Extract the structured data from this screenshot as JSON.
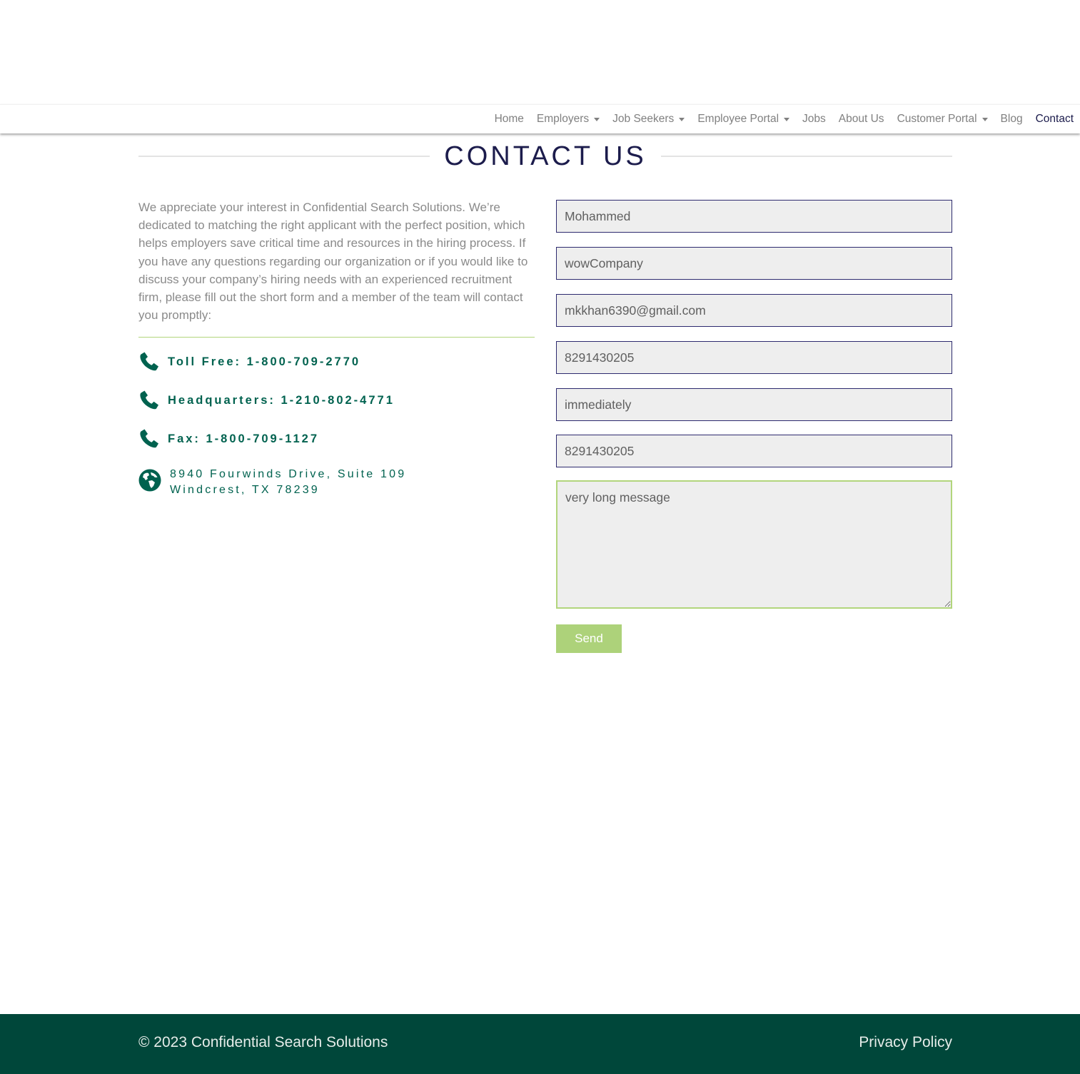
{
  "nav": {
    "items": [
      {
        "label": "Home",
        "dropdown": false
      },
      {
        "label": "Employers",
        "dropdown": true
      },
      {
        "label": "Job Seekers",
        "dropdown": true
      },
      {
        "label": "Employee Portal",
        "dropdown": true
      },
      {
        "label": "Jobs",
        "dropdown": false
      },
      {
        "label": "About Us",
        "dropdown": false
      },
      {
        "label": "Customer Portal",
        "dropdown": true
      },
      {
        "label": "Blog",
        "dropdown": false
      },
      {
        "label": "Contact",
        "dropdown": false,
        "active": true
      }
    ]
  },
  "page": {
    "title": "CONTACT US"
  },
  "intro": {
    "text": "We appreciate your interest in Confidential Search Solutions. We’re dedicated to matching the right applicant with the perfect position, which helps employers save critical time and resources in the hiring process. If you have any questions regarding our organization or if you would like to discuss your company’s hiring needs with an experienced recruitment firm, please fill out the short form and a member of the team will contact you promptly:"
  },
  "contact": {
    "toll_free": "Toll Free: 1-800-709-2770",
    "headquarters": "Headquarters: 1-210-802-4771",
    "fax": "Fax: 1-800-709-1127",
    "address_line1": "8940 Fourwinds Drive, Suite 109",
    "address_line2": "Windcrest, TX 78239",
    "icons": [
      "phone-icon",
      "phone-icon",
      "phone-icon",
      "globe-icon"
    ]
  },
  "form": {
    "name_value": "Mohammed",
    "company_value": "wowCompany",
    "email_value": "mkkhan6390@gmail.com",
    "phone_value": "8291430205",
    "availability_value": "immediately",
    "phone2_value": "8291430205",
    "message_value": "very long message",
    "send_label": "Send"
  },
  "footer": {
    "copyright": "© 2023 Confidential Search Solutions",
    "privacy": "Privacy Policy"
  },
  "colors": {
    "brand_navy": "#1c1c4c",
    "brand_green": "#00624f",
    "accent_lime": "#add27a",
    "footer_bg": "#00473a"
  }
}
